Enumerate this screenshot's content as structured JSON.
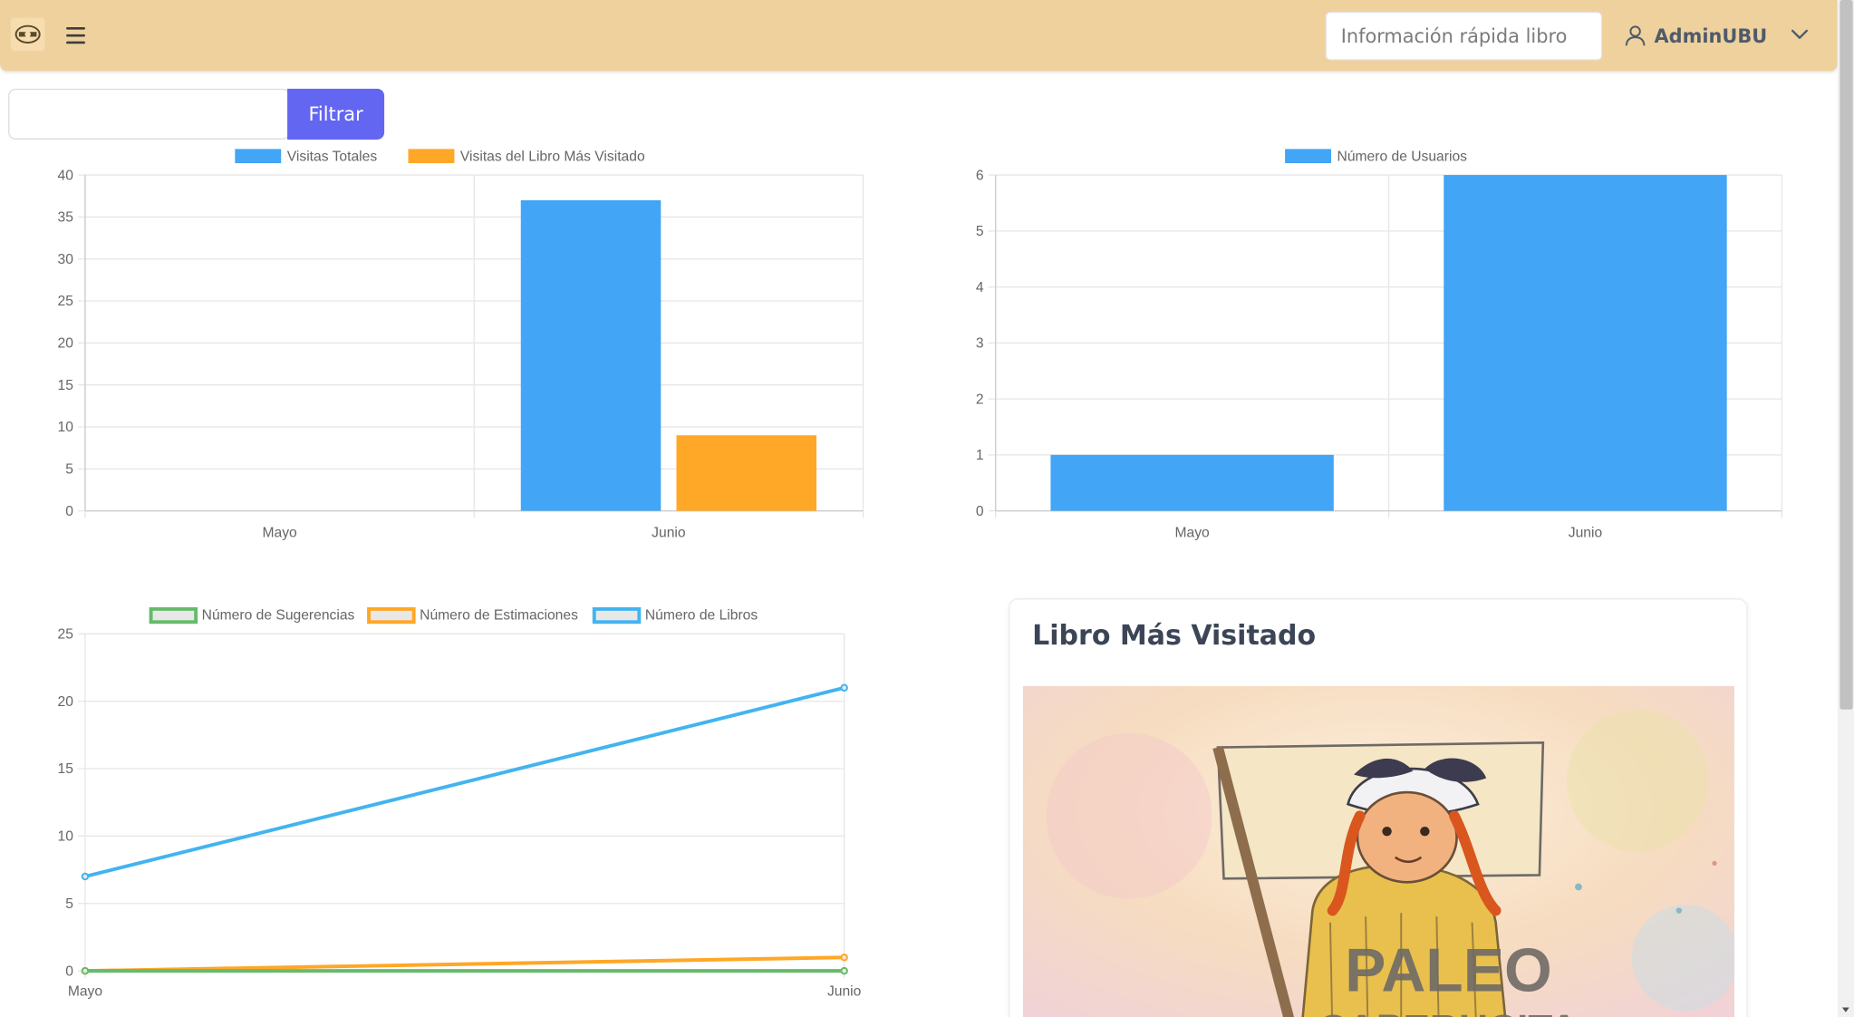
{
  "header": {
    "search_placeholder": "Información rápida libro",
    "user_name": "AdminUBU",
    "icons": {
      "logo": "app-logo",
      "menu": "hamburger-menu-icon",
      "user": "user-icon",
      "dropdown": "chevron-down-icon"
    },
    "bg_color": "#eed19d"
  },
  "filter": {
    "date_value": "",
    "button_label": "Filtrar",
    "button_color": "#6366f1"
  },
  "card": {
    "title": "Libro Más Visitado",
    "cover_text": [
      "PALEO",
      "CAPERUCITA"
    ]
  },
  "chart_data": [
    {
      "type": "bar",
      "categories": [
        "Mayo",
        "Junio"
      ],
      "series": [
        {
          "name": "Visitas Totales",
          "values": [
            0,
            37
          ],
          "color": "#42a5f5"
        },
        {
          "name": "Visitas del Libro Más Visitado",
          "values": [
            0,
            9
          ],
          "color": "#ffa726"
        }
      ],
      "ylim": [
        0,
        40
      ],
      "yticks": [
        0,
        5,
        10,
        15,
        20,
        25,
        30,
        35,
        40
      ],
      "legend": "top",
      "grid": true
    },
    {
      "type": "bar",
      "categories": [
        "Mayo",
        "Junio"
      ],
      "series": [
        {
          "name": "Número de Usuarios",
          "values": [
            1,
            6
          ],
          "color": "#42a5f5"
        }
      ],
      "ylim": [
        0,
        6
      ],
      "yticks": [
        0,
        1,
        2,
        3,
        4,
        5,
        6
      ],
      "legend": "top",
      "grid": true
    },
    {
      "type": "line",
      "categories": [
        "Mayo",
        "Junio"
      ],
      "series": [
        {
          "name": "Número de Sugerencias",
          "values": [
            0,
            0
          ],
          "color": "#66bb6a"
        },
        {
          "name": "Número de Estimaciones",
          "values": [
            0,
            1
          ],
          "color": "#ffa726"
        },
        {
          "name": "Número de Libros",
          "values": [
            7,
            21
          ],
          "color": "#42b4f0"
        }
      ],
      "ylim": [
        0,
        25
      ],
      "yticks": [
        0,
        5,
        10,
        15,
        20,
        25
      ],
      "legend": "top",
      "grid": true
    }
  ]
}
